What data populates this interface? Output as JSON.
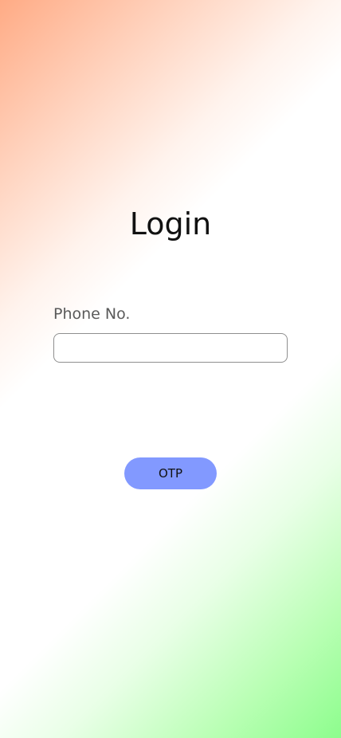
{
  "title": "Login",
  "phone": {
    "label": "Phone No.",
    "value": "",
    "placeholder": ""
  },
  "otp_button": {
    "label": "OTP"
  },
  "colors": {
    "top_left_gradient": "#ffab85",
    "bottom_right_gradient": "#8dfd8d",
    "button_bg": "#8299ff",
    "input_border": "#8f8f8f"
  }
}
